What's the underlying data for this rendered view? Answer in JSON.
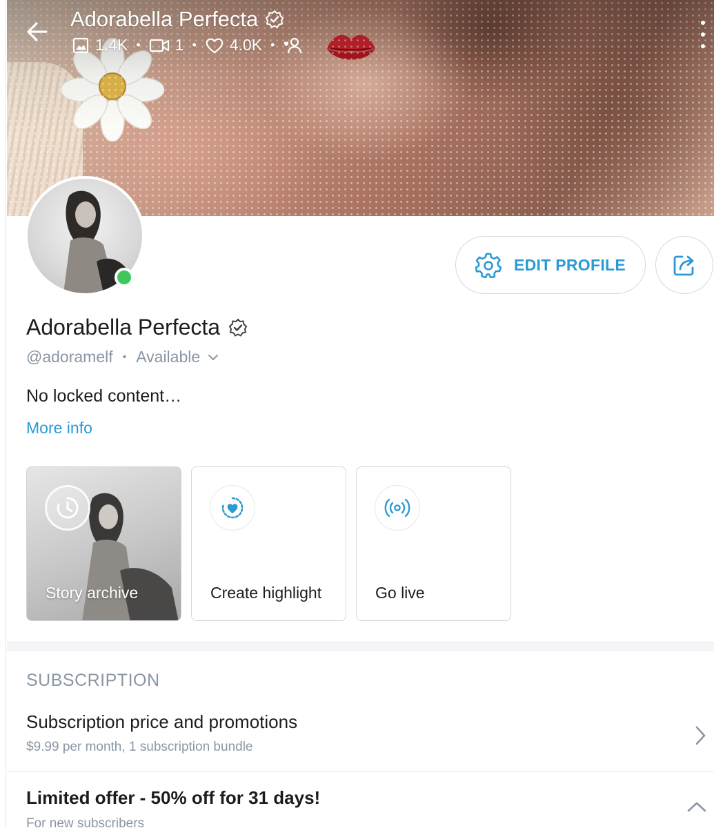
{
  "header": {
    "title": "Adorabella Perfecta",
    "stats": {
      "photos": "1.4K",
      "videos": "1",
      "likes": "4.0K"
    }
  },
  "profile": {
    "name": "Adorabella Perfecta",
    "handle": "@adoramelf",
    "status": "Available",
    "bio": "No locked content…",
    "more_info": "More info",
    "online": true
  },
  "actions": {
    "edit_profile": "EDIT PROFILE"
  },
  "story_cards": {
    "archive": "Story archive",
    "highlight": "Create highlight",
    "live": "Go live"
  },
  "subscription": {
    "section_title": "SUBSCRIPTION",
    "price_row": {
      "title": "Subscription price and promotions",
      "description": "$9.99 per month, 1 subscription bundle"
    },
    "offer_row": {
      "title": "Limited offer - 50% off for 31 days!",
      "description": "For new subscribers"
    }
  },
  "colors": {
    "accent": "#2a9ad4",
    "muted": "#8a96a3",
    "online": "#3ec85b",
    "text": "#1b1c1f"
  },
  "icons": [
    "back-arrow-icon",
    "verified-badge-icon",
    "image-icon",
    "video-icon",
    "heart-icon",
    "fans-icon",
    "kiss-lips-icon",
    "more-vertical-icon",
    "gear-icon",
    "share-icon",
    "chevron-down-icon",
    "clock-icon",
    "highlight-heart-icon",
    "broadcast-icon",
    "chevron-right-icon",
    "chevron-up-icon"
  ]
}
